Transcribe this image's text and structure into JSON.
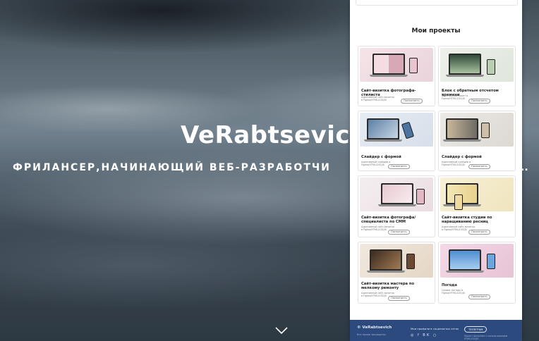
{
  "hero": {
    "title": "VeRabtsevich",
    "subtitle": "ФРИЛАНСЕР,НАЧИНАЮЩИЙ ВЕБ-РАЗРАБОТЧИ",
    "subtitle_tail": "..",
    "scroll_icon": "chevron-down-icon"
  },
  "projects": {
    "heading": "Мои проекты",
    "cards": [
      {
        "title": "Сайт-визитка фотографа-стилиста",
        "desc": "Адаптивный сайт-визитка в Figma/HTML/CSS/JS",
        "button": "Посмотреть"
      },
      {
        "title": "Блок с обратным отсчетом времени",
        "desc": "Адаптивный макет в Figma/HTML/CSS/JS",
        "button": "Посмотреть"
      },
      {
        "title": "Слайдер с формой",
        "desc": "Адаптивный слайдер в Figma/HTML/CSS/JS",
        "button": "Посмотреть"
      },
      {
        "title": "Слайдер с формой",
        "desc": "Адаптивный слайдер в Figma/HTML/CSS/JS",
        "button": "Посмотреть"
      },
      {
        "title": "Сайт-визитка фотографа/специалиста по СММ",
        "desc": "Адаптивный сайт-визитка в Figma/HTML/CSS/JS",
        "button": "Посмотреть"
      },
      {
        "title": "Сайт-визитка студии по наращиванию ресниц",
        "desc": "Адаптивный сайт-визитка в Figma/HTML/CSS/JS",
        "button": "Посмотреть"
      },
      {
        "title": "Сайт-визитка мастера по мелкому ремонту",
        "desc": "Адаптивный сайт-визитка в Figma/HTML/CSS/JS",
        "button": "Посмотреть"
      },
      {
        "title": "Погода",
        "desc": "Сервис погоды в Figma/HTML/CSS/JS",
        "button": "Посмотреть"
      }
    ]
  },
  "footer": {
    "brand": "© VeRabtsevich",
    "copy": "Все права защищены",
    "links_label": "Мои профили в социальных сетях",
    "icons": "◎ f ВК ○",
    "button": "ТЕЛЕГРАМ",
    "note": "Проект выполнен с использованием HTML/CSS/JS"
  },
  "colors": {
    "hero_text": "#ffffff",
    "panel_bg": "#ffffff",
    "footer_bg": "#2c4a7e"
  }
}
